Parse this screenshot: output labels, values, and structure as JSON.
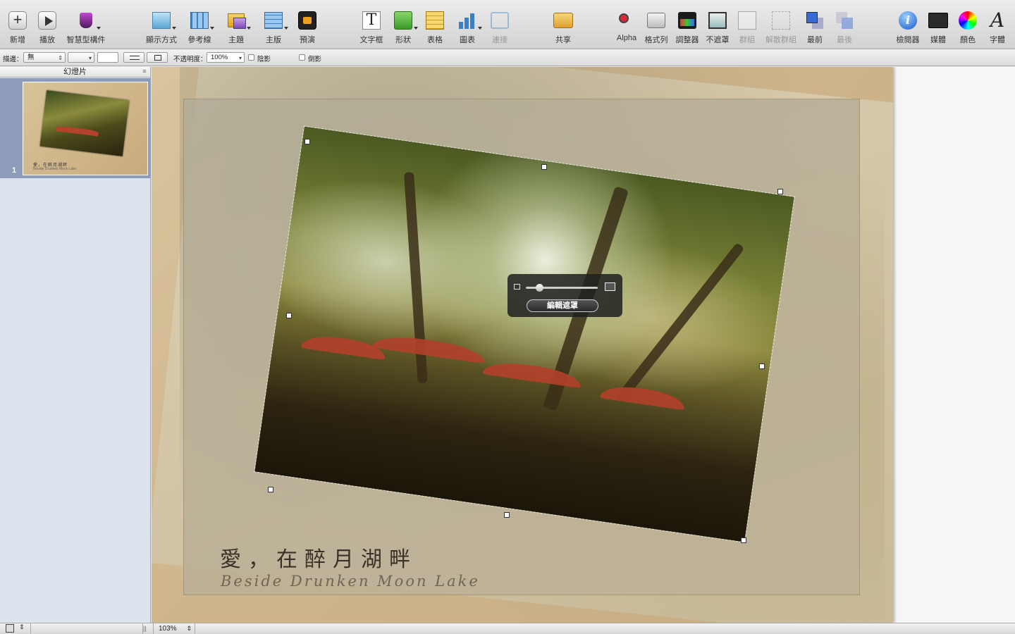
{
  "toolbar": {
    "items": [
      {
        "label": "新增",
        "icon": "plus-icon"
      },
      {
        "label": "播放",
        "icon": "play-icon"
      },
      {
        "label": "智慧型構件",
        "icon": "smart-build-icon"
      },
      {
        "label": "顯示方式",
        "icon": "view-icon"
      },
      {
        "label": "參考線",
        "icon": "guides-icon"
      },
      {
        "label": "主題",
        "icon": "themes-icon"
      },
      {
        "label": "主版",
        "icon": "masters-icon"
      },
      {
        "label": "預演",
        "icon": "rehearse-icon"
      },
      {
        "label": "文字框",
        "icon": "textbox-icon"
      },
      {
        "label": "形狀",
        "icon": "shapes-icon"
      },
      {
        "label": "表格",
        "icon": "table-icon"
      },
      {
        "label": "圖表",
        "icon": "chart-icon"
      },
      {
        "label": "連接",
        "icon": "connect-icon"
      },
      {
        "label": "共享",
        "icon": "share-icon"
      },
      {
        "label": "Alpha",
        "icon": "alpha-icon"
      },
      {
        "label": "格式列",
        "icon": "format-bar-icon"
      },
      {
        "label": "調整器",
        "icon": "adjust-icon"
      },
      {
        "label": "不遮罩",
        "icon": "unmask-icon"
      },
      {
        "label": "群組",
        "icon": "group-icon"
      },
      {
        "label": "解散群組",
        "icon": "ungroup-icon"
      },
      {
        "label": "最前",
        "icon": "front-icon"
      },
      {
        "label": "最後",
        "icon": "back-icon"
      },
      {
        "label": "檢閱器",
        "icon": "inspector-icon"
      },
      {
        "label": "媒體",
        "icon": "media-icon"
      },
      {
        "label": "顏色",
        "icon": "colors-icon"
      },
      {
        "label": "字體",
        "icon": "fonts-icon"
      }
    ]
  },
  "formatbar": {
    "stroke_label": "描邊：",
    "stroke_value": "無",
    "opacity_label": "不透明度：",
    "opacity_value": "100%",
    "shadow_label": "陰影",
    "reflection_label": "倒影"
  },
  "sidebar": {
    "header": "幻燈片",
    "slides": [
      {
        "number": "1",
        "thumb_title": "愛，在醉月湖畔",
        "thumb_subtitle": "Beside Drunken Moon Lake"
      }
    ]
  },
  "slide": {
    "title": "愛，在醉月湖畔",
    "subtitle": "Beside Drunken Moon Lake"
  },
  "mask_hud": {
    "edit_mask_label": "編輯遮罩",
    "slider_value": 0.15
  },
  "statusbar": {
    "zoom": "103%"
  }
}
